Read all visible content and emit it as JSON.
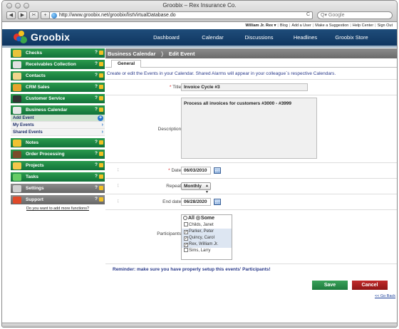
{
  "browser": {
    "window_title": "Groobix – Rex Insurance Co.",
    "back_label": "◀",
    "forward_label": "▶",
    "bookmarks_label": "✂",
    "add_label": "+",
    "url": "http://www.groobix.net/groobix/listVirtualDatabase.do",
    "reload_label": "C",
    "search_placeholder": "Q▾ Google"
  },
  "top_links": [
    "William Jr. Rex ▾",
    "Blog",
    "Add a User",
    "Make a Suggestion",
    "Help Center",
    "Sign Out"
  ],
  "header": {
    "logo_text": "Groobix",
    "nav": [
      "Dashboard",
      "Calendar",
      "Discussions",
      "Headlines",
      "Groobix Store"
    ]
  },
  "sidebar": {
    "items": [
      {
        "label": "Checks",
        "icon": "checks-icon",
        "color": "#e9c33a"
      },
      {
        "label": "Receivables Collection",
        "icon": "receivables-icon",
        "color": "#e0e0e0"
      },
      {
        "label": "Contacts",
        "icon": "contacts-icon",
        "color": "#f0d58c"
      },
      {
        "label": "CRM Sales",
        "icon": "crm-sales-icon",
        "color": "#e6a52b"
      },
      {
        "label": "Customer Service",
        "icon": "headset-icon",
        "color": "#333333"
      },
      {
        "label": "Business Calendar",
        "icon": "clock-icon",
        "color": "#e8e8e8"
      }
    ],
    "calendar_sub": [
      "Add Event",
      "My Events",
      "Shared Events"
    ],
    "items_after": [
      {
        "label": "Notes",
        "icon": "notes-icon",
        "color": "#f1c232"
      },
      {
        "label": "Order Processing",
        "icon": "order-processing-icon",
        "color": "#7a4d2a"
      },
      {
        "label": "Projects",
        "icon": "projects-icon",
        "color": "#f3c74a"
      },
      {
        "label": "Tasks",
        "icon": "tasks-icon",
        "color": "#66cc66"
      },
      {
        "label": "Settings",
        "icon": "settings-icon",
        "color": "#d0d0d0"
      },
      {
        "label": "Support",
        "icon": "support-icon",
        "color": "#e04a2a"
      }
    ],
    "help_label": "?",
    "add_functions_link": "Do you want to add more functions?"
  },
  "main": {
    "breadcrumb": [
      "Business Calendar",
      "Edit Event"
    ],
    "breadcrumb_sep": "❭",
    "tab": "General",
    "intro": "Create or edit the Events in your Calendar. Shared Alarms will appear in your colleague`s respective Calendars.",
    "title_label": "Title:",
    "title_value": "Invoice Cycle #3",
    "description_label": "Description:",
    "description_value": "Process all invoices for customers #3000 - #3999",
    "date_label": "Date:",
    "date_value": "06/03/2010",
    "repeat_label": "Repeat:",
    "repeat_value": "Monthly",
    "end_date_label": "End date:",
    "end_date_value": "06/28/2020",
    "participants_label": "Participants:",
    "participants_mode": {
      "all": "All",
      "some": "Some"
    },
    "participants": [
      {
        "name": "Childs, Janet",
        "checked": false
      },
      {
        "name": "Parker, Peter",
        "checked": true
      },
      {
        "name": "Quincy, Carol",
        "checked": true
      },
      {
        "name": "Rex, William Jr.",
        "checked": true
      },
      {
        "name": "Sims, Larry",
        "checked": false
      }
    ],
    "reminder": "Reminder: make sure you have properly setup this events' Participants!",
    "save_label": "Save",
    "cancel_label": "Cancel",
    "go_back": "<< Go Back",
    "required_mark": "*",
    "marker_glyph": "↨"
  }
}
